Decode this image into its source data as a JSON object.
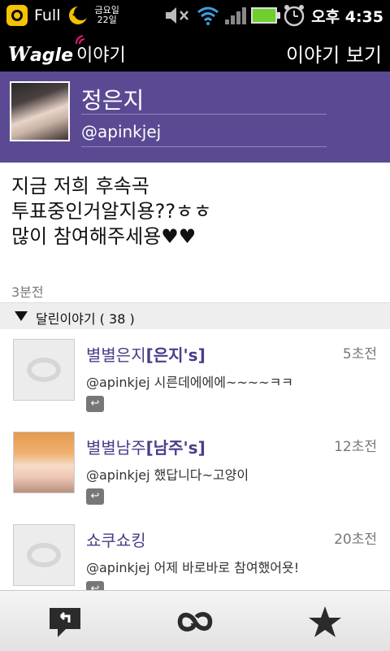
{
  "status": {
    "full_label": "Full",
    "day_label": "금요일",
    "date_label": "22일",
    "time": "오후 4:35"
  },
  "appbar": {
    "logo_w": "W",
    "logo_agle": "agle",
    "logo_ko": "이야기",
    "title": "이야기 보기"
  },
  "profile": {
    "name": "정은지",
    "handle": "@apinkjej"
  },
  "post": {
    "text": "지금 저희 후속곡\n투표중인거알지용??ㅎㅎ\n많이 참여해주세용♥♥",
    "time": "3분전"
  },
  "comments_header": {
    "label": "달린이야기 ( 38 )"
  },
  "comments": [
    {
      "name": "별별은지",
      "tag": "[은지's]",
      "time": "5초전",
      "text": "@apinkjej 시른데에에에~~~~ㅋㅋ",
      "avatar": "wagle-default"
    },
    {
      "name": "별별남주",
      "tag": "[남주's]",
      "time": "12초전",
      "text": "@apinkjej 했답니다~고양이",
      "avatar": "photo"
    },
    {
      "name": "쇼쿠쇼킹",
      "tag": "",
      "time": "20초전",
      "text": "@apinkjej 어제 바로바로 참여했어욧!",
      "avatar": "wagle-default"
    }
  ],
  "bottombar": {
    "icons": [
      "reply-icon",
      "retweet-icon",
      "star-icon"
    ]
  },
  "colors": {
    "brand_purple": "#5b4a93",
    "name_purple": "#4a3d8a"
  }
}
